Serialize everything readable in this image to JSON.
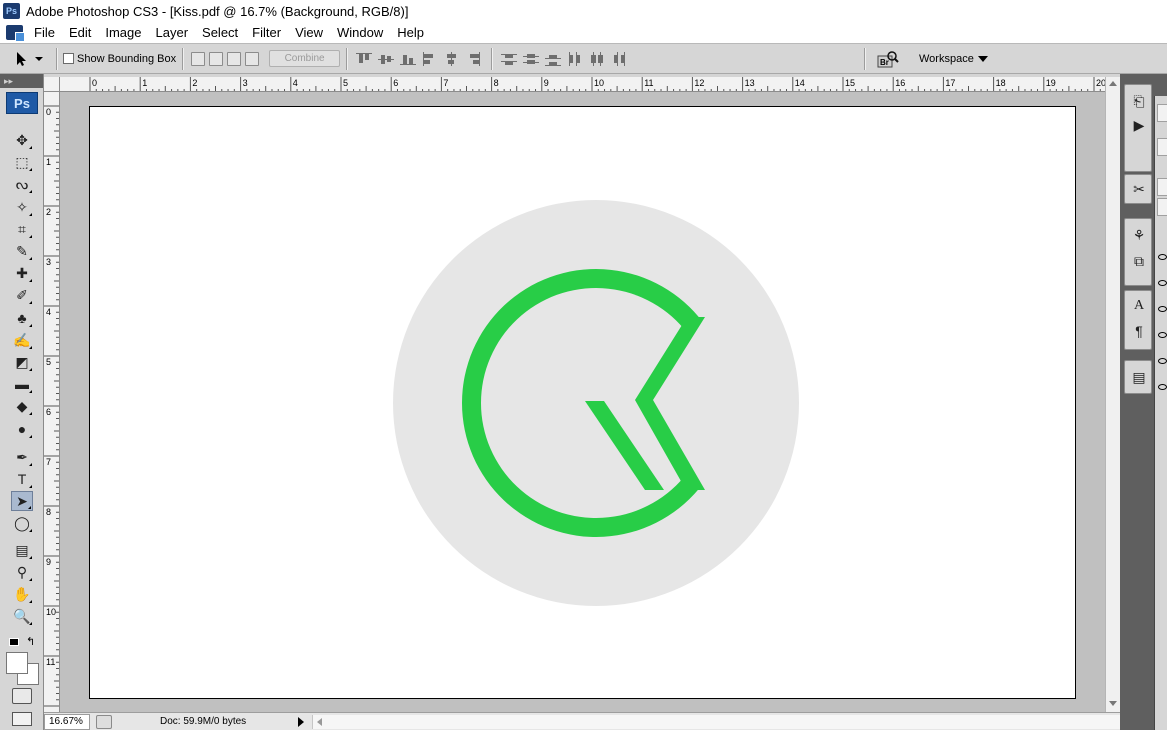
{
  "app": {
    "title": "Adobe Photoshop CS3 - [Kiss.pdf @ 16.7% (Background, RGB/8)]",
    "logo_text": "Ps"
  },
  "menu": [
    "File",
    "Edit",
    "Image",
    "Layer",
    "Select",
    "Filter",
    "View",
    "Window",
    "Help"
  ],
  "options_bar": {
    "tool_icon": "path-selection-icon",
    "show_bounding_box_label": "Show Bounding Box",
    "show_bounding_box_checked": false,
    "combine_label": "Combine",
    "bridge_icon": "bridge-icon",
    "workspace_label": "Workspace"
  },
  "toolbox": {
    "logo_text": "Ps",
    "tools": [
      {
        "name": "move-tool-icon",
        "glyph": "✥"
      },
      {
        "name": "marquee-tool-icon",
        "glyph": "⬚"
      },
      {
        "name": "lasso-tool-icon",
        "glyph": "ᔓ"
      },
      {
        "name": "magic-wand-tool-icon",
        "glyph": "✧"
      },
      {
        "name": "crop-tool-icon",
        "glyph": "⌗"
      },
      {
        "name": "slice-tool-icon",
        "glyph": "✎"
      },
      {
        "name": "healing-brush-tool-icon",
        "glyph": "✚"
      },
      {
        "name": "brush-tool-icon",
        "glyph": "✐"
      },
      {
        "name": "clone-stamp-tool-icon",
        "glyph": "♣"
      },
      {
        "name": "history-brush-tool-icon",
        "glyph": "✍"
      },
      {
        "name": "eraser-tool-icon",
        "glyph": "◩"
      },
      {
        "name": "gradient-tool-icon",
        "glyph": "▬"
      },
      {
        "name": "blur-tool-icon",
        "glyph": "◆"
      },
      {
        "name": "dodge-tool-icon",
        "glyph": "●"
      },
      {
        "name": "pen-tool-icon",
        "glyph": "✒"
      },
      {
        "name": "type-tool-icon",
        "glyph": "T"
      },
      {
        "name": "path-selection-tool-icon",
        "glyph": "➤"
      },
      {
        "name": "ellipse-tool-icon",
        "glyph": "◯"
      },
      {
        "name": "notes-tool-icon",
        "glyph": "▤"
      },
      {
        "name": "eyedropper-tool-icon",
        "glyph": "⚲"
      },
      {
        "name": "hand-tool-icon",
        "glyph": "✋"
      },
      {
        "name": "zoom-tool-icon",
        "glyph": "🔍"
      }
    ],
    "active_tool": "path-selection-tool-icon"
  },
  "rulers": {
    "top_labels": [
      "0",
      "1",
      "2",
      "3",
      "4",
      "5",
      "6",
      "7",
      "8",
      "9",
      "10",
      "11",
      "12",
      "13",
      "14",
      "15",
      "16",
      "17",
      "18",
      "19",
      "20"
    ],
    "left_labels": [
      "0",
      "1",
      "2",
      "3",
      "4",
      "5",
      "6",
      "7",
      "8",
      "9",
      "10",
      "11"
    ]
  },
  "document": {
    "name": "Kiss.pdf",
    "background_color": "#ffffff",
    "circle_color": "#e6e6e6",
    "logo_color": "#28cd47"
  },
  "status_bar": {
    "zoom": "16.67%",
    "doc_info": "Doc: 59.9M/0 bytes"
  },
  "dock": {
    "buttons": [
      "history-icon",
      "actions-icon",
      "tools-presets-icon",
      "clone-source-icon",
      "layer-comps-icon",
      "character-icon",
      "paragraph-icon",
      "info-panel-icon"
    ]
  }
}
